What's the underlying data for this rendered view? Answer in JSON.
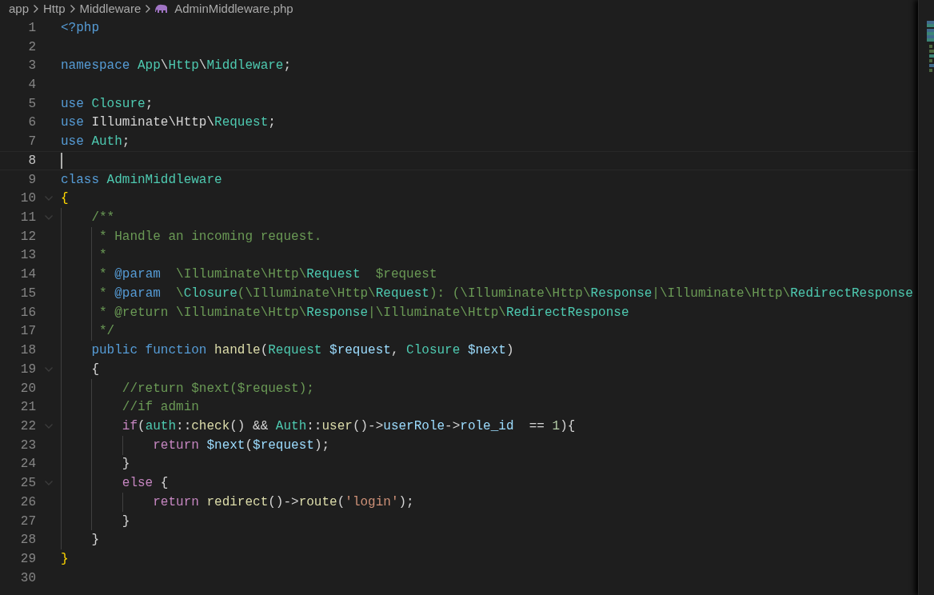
{
  "breadcrumbs": [
    {
      "label": "app",
      "kind": "folder"
    },
    {
      "label": "Http",
      "kind": "folder"
    },
    {
      "label": "Middleware",
      "kind": "folder"
    },
    {
      "label": "AdminMiddleware.php",
      "kind": "php-file"
    }
  ],
  "lines": [
    {
      "number": "1",
      "current": false,
      "foldable": false,
      "tokens": [
        {
          "text": "<?php",
          "kind": "keyword"
        }
      ]
    },
    {
      "number": "2",
      "current": false,
      "foldable": false
    },
    {
      "number": "3",
      "current": false,
      "foldable": false,
      "tokens": [
        {
          "text": "namespace ",
          "kind": "keyword"
        },
        {
          "text": "App",
          "kind": "type"
        },
        {
          "text": "\\",
          "kind": "plain"
        },
        {
          "text": "Http",
          "kind": "type"
        },
        {
          "text": "\\",
          "kind": "plain"
        },
        {
          "text": "Middleware",
          "kind": "type"
        },
        {
          "text": ";",
          "kind": "plain"
        }
      ]
    },
    {
      "number": "4",
      "current": false,
      "foldable": false
    },
    {
      "number": "5",
      "current": false,
      "foldable": false,
      "tokens": [
        {
          "text": "use ",
          "kind": "keyword"
        },
        {
          "text": "Closure",
          "kind": "type"
        },
        {
          "text": ";",
          "kind": "plain"
        }
      ]
    },
    {
      "number": "6",
      "current": false,
      "foldable": false,
      "tokens": [
        {
          "text": "use",
          "kind": "keyword"
        },
        {
          "text": " Illuminate\\Http\\",
          "kind": "plain"
        },
        {
          "text": "Request",
          "kind": "type"
        },
        {
          "text": ";",
          "kind": "plain"
        }
      ]
    },
    {
      "number": "7",
      "current": false,
      "foldable": false,
      "tokens": [
        {
          "text": "use ",
          "kind": "keyword"
        },
        {
          "text": "Auth",
          "kind": "type"
        },
        {
          "text": ";",
          "kind": "plain"
        }
      ]
    },
    {
      "number": "8",
      "current": true,
      "foldable": false
    },
    {
      "number": "9",
      "current": false,
      "foldable": false,
      "tokens": [
        {
          "text": "class ",
          "kind": "keyword"
        },
        {
          "text": "AdminMiddleware",
          "kind": "type"
        }
      ]
    },
    {
      "number": "10",
      "current": false,
      "foldable": true,
      "tokens": [
        {
          "text": "{",
          "kind": "bracket"
        }
      ]
    },
    {
      "number": "11",
      "current": false,
      "foldable": true,
      "tokens": [
        {
          "text": "    /**",
          "kind": "comment"
        }
      ]
    },
    {
      "number": "12",
      "current": false,
      "foldable": false,
      "tokens": [
        {
          "text": "     * Handle an incoming request.",
          "kind": "comment"
        }
      ]
    },
    {
      "number": "13",
      "current": false,
      "foldable": false,
      "tokens": [
        {
          "text": "     *",
          "kind": "comment"
        }
      ]
    },
    {
      "number": "14",
      "current": false,
      "foldable": false,
      "tokens": [
        {
          "text": "     * ",
          "kind": "comment"
        },
        {
          "text": "@param",
          "kind": "keyword"
        },
        {
          "text": "  \\Illuminate\\Http\\",
          "kind": "comment"
        },
        {
          "text": "Request",
          "kind": "type"
        },
        {
          "text": "  $request",
          "kind": "comment"
        }
      ]
    },
    {
      "number": "15",
      "current": false,
      "foldable": false,
      "tokens": [
        {
          "text": "     * ",
          "kind": "comment"
        },
        {
          "text": "@param",
          "kind": "keyword"
        },
        {
          "text": "  \\",
          "kind": "comment"
        },
        {
          "text": "Closure",
          "kind": "type"
        },
        {
          "text": "(\\Illuminate\\Http\\",
          "kind": "comment"
        },
        {
          "text": "Request",
          "kind": "type"
        },
        {
          "text": "): (\\Illuminate\\Http\\",
          "kind": "comment"
        },
        {
          "text": "Response",
          "kind": "type"
        },
        {
          "text": "|\\Illuminate\\Http\\",
          "kind": "comment"
        },
        {
          "text": "RedirectResponse",
          "kind": "type"
        }
      ]
    },
    {
      "number": "16",
      "current": false,
      "foldable": false,
      "tokens": [
        {
          "text": "     * @return \\Illuminate\\Http\\",
          "kind": "comment"
        },
        {
          "text": "Response",
          "kind": "type"
        },
        {
          "text": "|\\Illuminate\\Http\\",
          "kind": "comment"
        },
        {
          "text": "RedirectResponse",
          "kind": "type"
        }
      ]
    },
    {
      "number": "17",
      "current": false,
      "foldable": false,
      "tokens": [
        {
          "text": "     */",
          "kind": "comment"
        }
      ]
    },
    {
      "number": "18",
      "current": false,
      "foldable": false,
      "tokens": [
        {
          "text": "    public function ",
          "kind": "keyword"
        },
        {
          "text": "handle",
          "kind": "function"
        },
        {
          "text": "(",
          "kind": "plain"
        },
        {
          "text": "Request ",
          "kind": "type"
        },
        {
          "text": "$request",
          "kind": "variable"
        },
        {
          "text": ", ",
          "kind": "plain"
        },
        {
          "text": "Closure ",
          "kind": "type"
        },
        {
          "text": "$next",
          "kind": "variable"
        },
        {
          "text": ")",
          "kind": "plain"
        }
      ]
    },
    {
      "number": "19",
      "current": false,
      "foldable": true,
      "tokens": [
        {
          "text": "    {",
          "kind": "plain"
        }
      ]
    },
    {
      "number": "20",
      "current": false,
      "foldable": false,
      "tokens": [
        {
          "text": "        //return $next($request);",
          "kind": "comment"
        }
      ]
    },
    {
      "number": "21",
      "current": false,
      "foldable": false,
      "tokens": [
        {
          "text": "        //if admin",
          "kind": "comment"
        }
      ]
    },
    {
      "number": "22",
      "current": false,
      "foldable": true,
      "tokens": [
        {
          "text": "        if",
          "kind": "control"
        },
        {
          "text": "(",
          "kind": "plain"
        },
        {
          "text": "auth",
          "kind": "type"
        },
        {
          "text": "::",
          "kind": "plain"
        },
        {
          "text": "check",
          "kind": "function"
        },
        {
          "text": "() && ",
          "kind": "plain"
        },
        {
          "text": "Auth",
          "kind": "type"
        },
        {
          "text": "::",
          "kind": "plain"
        },
        {
          "text": "user",
          "kind": "function"
        },
        {
          "text": "()->",
          "kind": "plain"
        },
        {
          "text": "userRole",
          "kind": "variable"
        },
        {
          "text": "->",
          "kind": "plain"
        },
        {
          "text": "role_id",
          "kind": "variable"
        },
        {
          "text": "  == ",
          "kind": "plain"
        },
        {
          "text": "1",
          "kind": "number"
        },
        {
          "text": "){",
          "kind": "plain"
        }
      ]
    },
    {
      "number": "23",
      "current": false,
      "foldable": false,
      "tokens": [
        {
          "text": "            return ",
          "kind": "control"
        },
        {
          "text": "$next",
          "kind": "variable"
        },
        {
          "text": "(",
          "kind": "plain"
        },
        {
          "text": "$request",
          "kind": "variable"
        },
        {
          "text": ");",
          "kind": "plain"
        }
      ]
    },
    {
      "number": "24",
      "current": false,
      "foldable": false,
      "tokens": [
        {
          "text": "        }",
          "kind": "plain"
        }
      ]
    },
    {
      "number": "25",
      "current": false,
      "foldable": true,
      "tokens": [
        {
          "text": "        else",
          "kind": "control"
        },
        {
          "text": " {",
          "kind": "plain"
        }
      ]
    },
    {
      "number": "26",
      "current": false,
      "foldable": false,
      "tokens": [
        {
          "text": "            return ",
          "kind": "control"
        },
        {
          "text": "redirect",
          "kind": "function"
        },
        {
          "text": "()->",
          "kind": "plain"
        },
        {
          "text": "route",
          "kind": "function"
        },
        {
          "text": "(",
          "kind": "plain"
        },
        {
          "text": "'login'",
          "kind": "string"
        },
        {
          "text": ");",
          "kind": "plain"
        }
      ]
    },
    {
      "number": "27",
      "current": false,
      "foldable": false,
      "tokens": [
        {
          "text": "        }",
          "kind": "plain"
        }
      ]
    },
    {
      "number": "28",
      "current": false,
      "foldable": false,
      "tokens": [
        {
          "text": "    }",
          "kind": "plain"
        }
      ]
    },
    {
      "number": "29",
      "current": false,
      "foldable": false,
      "tokens": [
        {
          "text": "}",
          "kind": "bracket"
        }
      ]
    },
    {
      "number": "30",
      "current": false,
      "foldable": false
    }
  ]
}
